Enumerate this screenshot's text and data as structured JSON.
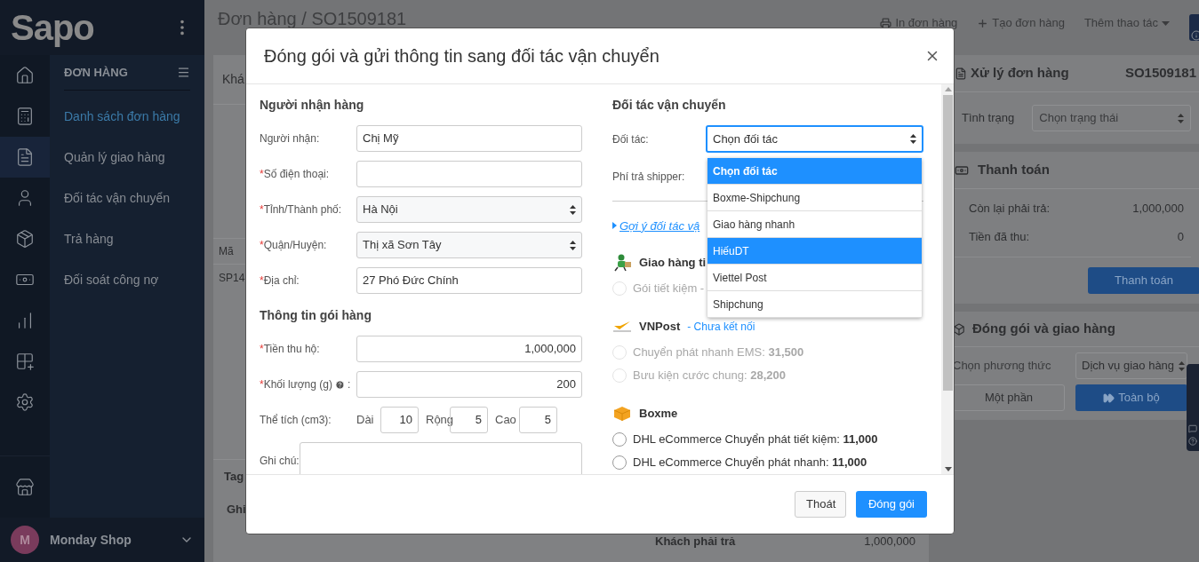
{
  "sidebar": {
    "brand": "Sapo",
    "rail_items": [
      {
        "kind": "home",
        "selected": false
      },
      {
        "kind": "register",
        "selected": false
      },
      {
        "kind": "invoice",
        "selected": true
      },
      {
        "kind": "customer",
        "selected": false
      },
      {
        "kind": "product",
        "selected": false
      },
      {
        "kind": "cash",
        "selected": false
      },
      {
        "kind": "report",
        "selected": false
      },
      {
        "kind": "apps",
        "selected": false
      },
      {
        "kind": "settings",
        "selected": false
      }
    ],
    "store_item": {
      "kind": "store"
    },
    "menu": {
      "title": "ĐƠN HÀNG",
      "items": [
        {
          "label": "Danh sách đơn hàng",
          "selected": true
        },
        {
          "label": "Quản lý giao hàng",
          "selected": false
        },
        {
          "label": "Đối tác vận chuyển",
          "selected": false
        },
        {
          "label": "Trả hàng",
          "selected": false
        },
        {
          "label": "Đối soát công nợ",
          "selected": false
        }
      ]
    },
    "account": {
      "initial": "M",
      "name": "Monday Shop"
    }
  },
  "page": {
    "breadcrumb": "Đơn hàng / SO1509181",
    "actions": [
      {
        "kind": "print",
        "label": "In đơn hàng"
      },
      {
        "kind": "add",
        "label": "Tạo đơn hàng"
      },
      {
        "kind": "more",
        "label": "Thêm thao tác"
      }
    ]
  },
  "order_card": {
    "tab": "Khá",
    "column_1": "Mã",
    "cell_1": "SP14",
    "tag_label": "Tag",
    "note_label": "Ghi",
    "total_label": "Khách phải trả",
    "total_value": "1,000,000"
  },
  "side_panel": {
    "process": {
      "title": "Xử lý đơn hàng",
      "code": "SO1509181",
      "status_label": "Tình trạng",
      "status_value": "Chọn trạng thái"
    },
    "payment": {
      "title": "Thanh toán",
      "rows": [
        {
          "label": "Còn lại phải trả:",
          "value": "1,000,000"
        },
        {
          "label": "Tiền đã thu:",
          "value": "0"
        }
      ],
      "button": "Thanh toán"
    },
    "shipping": {
      "title": "Đóng gói và giao hàng",
      "method_label": "Chọn phương thức",
      "method_value": "Dịch vụ giao hàng",
      "buttons": [
        {
          "label": "Một phần",
          "primary": false
        },
        {
          "label": "Toàn bộ",
          "primary": true
        }
      ]
    }
  },
  "modal": {
    "title": "Đóng gói và gửi thông tin sang đối tác vận chuyển",
    "recipient": {
      "heading": "Người nhận hàng",
      "fields": [
        {
          "label": "Người nhận:",
          "kind": "input",
          "value": "Chị Mỹ"
        },
        {
          "label": "Số điện thoại:",
          "mark": "*",
          "kind": "input"
        },
        {
          "label": "Tỉnh/Thành phố:",
          "mark": "*",
          "kind": "select",
          "value": "Hà Nội"
        },
        {
          "label": "Quận/Huyện:",
          "mark": "*",
          "kind": "select",
          "value": "Thị xã Sơn Tây"
        },
        {
          "label": "Địa chỉ:",
          "mark": "*",
          "kind": "input",
          "value": "27 Phó Đức Chính"
        }
      ]
    },
    "package": {
      "heading": "Thông tin gói hàng",
      "cod": {
        "mark": "*",
        "label": "Tiền thu hộ:",
        "value": "1,000,000"
      },
      "weight": {
        "mark": "*",
        "label": "Khối lượng (g)",
        "help": true,
        "suffix": ":",
        "value": "200"
      },
      "volume": {
        "label": "Thể tích (cm3):",
        "dims": [
          {
            "label": "Dài",
            "value": "10"
          },
          {
            "label": "Rộng",
            "value": "5"
          },
          {
            "label": "Cao",
            "value": "5"
          }
        ]
      },
      "note": {
        "label": "Ghi chú:"
      }
    },
    "carrier": {
      "heading": "Đối tác vận chuyển",
      "partner_label": "Đối tác:",
      "partner_value": "Chọn đối tác",
      "fee_label": "Phí trả shipper:",
      "dropdown": [
        {
          "label": "Chọn đối tác",
          "selected": true,
          "hovered": false
        },
        {
          "label": "Boxme-Shipchung",
          "selected": false,
          "hovered": false
        },
        {
          "label": "Giao hàng nhanh",
          "selected": false,
          "hovered": false
        },
        {
          "label": "HiếuDT",
          "selected": false,
          "hovered": true
        },
        {
          "label": "Viettel Post",
          "selected": false,
          "hovered": false
        },
        {
          "label": "Shipchung",
          "selected": false,
          "hovered": false
        }
      ],
      "suggest_link": "Gợi ý đối tác vậ",
      "groups": [
        {
          "kind": "courier",
          "name": "Giao hàng ti",
          "options": [
            {
              "text": "Gói tiết kiệm -",
              "disabled": true,
              "checked": false
            }
          ]
        },
        {
          "kind": "post",
          "name": "VNPost",
          "status": "- Chưa kết nối",
          "options": [
            {
              "text": "Chuyển phát nhanh EMS: **31,500**",
              "disabled": true,
              "checked": false
            },
            {
              "text": "Bưu kiện cước chung: **28,200**",
              "disabled": true,
              "checked": false
            }
          ]
        },
        {
          "kind": "box",
          "name": "Boxme",
          "options": [
            {
              "text": "DHL eCommerce Chuyển phát tiết kiệm: **11,000**",
              "disabled": false,
              "checked": false
            },
            {
              "text": "DHL eCommerce Chuyển phát nhanh: **11,000**",
              "disabled": false,
              "checked": false
            }
          ]
        }
      ]
    },
    "buttons": [
      {
        "label": "Thoát",
        "primary": false
      },
      {
        "label": "Đóng gói",
        "primary": true
      }
    ]
  }
}
